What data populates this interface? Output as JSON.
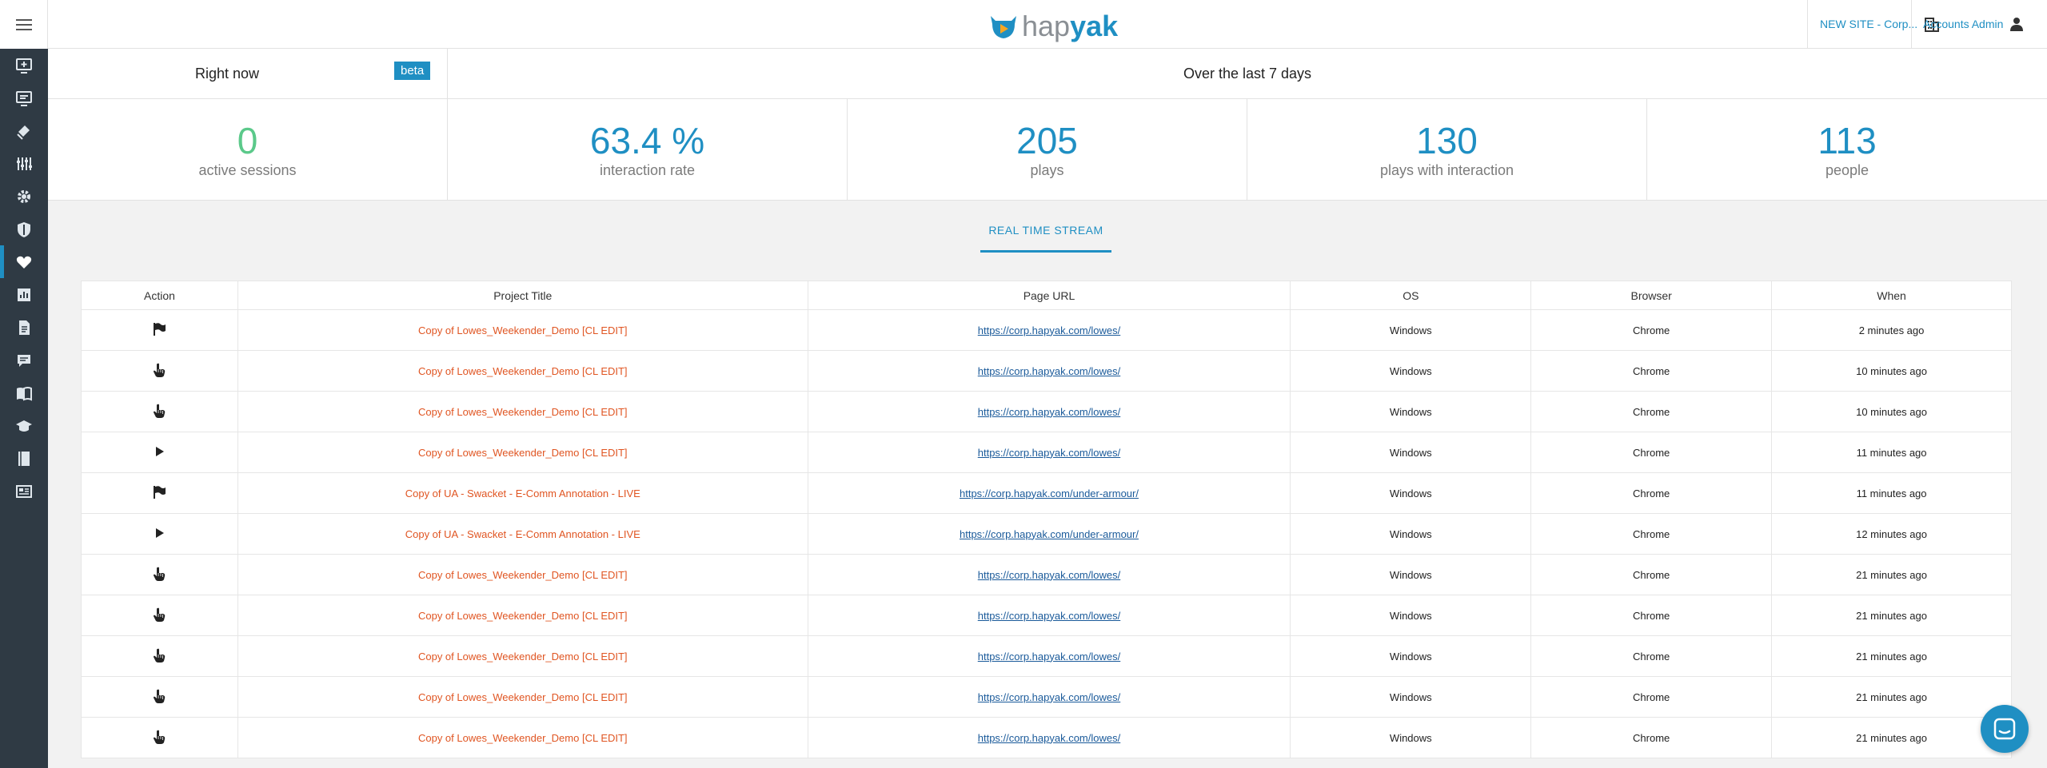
{
  "brand": {
    "part1": "hap",
    "part2": "yak",
    "accent": "#1f8fc3"
  },
  "header": {
    "site_label": "NEW SITE - Corp...",
    "account_label": "Accounts Admin"
  },
  "sidebar": {
    "items": [
      {
        "icon": "monitor-plus-icon"
      },
      {
        "icon": "screen-list-icon"
      },
      {
        "icon": "layers-icon"
      },
      {
        "icon": "sliders-icon"
      },
      {
        "icon": "gear-icon"
      },
      {
        "icon": "shield-icon"
      },
      {
        "icon": "heart-icon",
        "active": true
      },
      {
        "icon": "bar-chart-icon"
      },
      {
        "icon": "document-icon"
      },
      {
        "icon": "chat-icon"
      },
      {
        "icon": "book-open-icon"
      },
      {
        "icon": "graduation-cap-icon"
      },
      {
        "icon": "book-icon"
      },
      {
        "icon": "newspaper-icon"
      }
    ]
  },
  "stats": {
    "right_now": "Right now",
    "beta": "beta",
    "last7": "Over the last 7 days",
    "active_sessions": {
      "value": "0",
      "label": "active sessions"
    },
    "interaction_rate": {
      "value": "63.4 %",
      "label": "interaction rate"
    },
    "plays": {
      "value": "205",
      "label": "plays"
    },
    "plays_with_interaction": {
      "value": "130",
      "label": "plays with interaction"
    },
    "people": {
      "value": "113",
      "label": "people"
    }
  },
  "tab": {
    "label": "REAL TIME STREAM"
  },
  "table": {
    "headers": [
      "Action",
      "Project Title",
      "Page URL",
      "OS",
      "Browser",
      "When"
    ],
    "rows": [
      {
        "action": "flag-icon",
        "title": "Copy of Lowes_Weekender_Demo [CL EDIT]",
        "url": "https://corp.hapyak.com/lowes/",
        "os": "Windows",
        "browser": "Chrome",
        "when": "2 minutes ago"
      },
      {
        "action": "hand-pointer-icon",
        "title": "Copy of Lowes_Weekender_Demo [CL EDIT]",
        "url": "https://corp.hapyak.com/lowes/",
        "os": "Windows",
        "browser": "Chrome",
        "when": "10 minutes ago"
      },
      {
        "action": "hand-pointer-icon",
        "title": "Copy of Lowes_Weekender_Demo [CL EDIT]",
        "url": "https://corp.hapyak.com/lowes/",
        "os": "Windows",
        "browser": "Chrome",
        "when": "10 minutes ago"
      },
      {
        "action": "play-icon",
        "title": "Copy of Lowes_Weekender_Demo [CL EDIT]",
        "url": "https://corp.hapyak.com/lowes/",
        "os": "Windows",
        "browser": "Chrome",
        "when": "11 minutes ago"
      },
      {
        "action": "flag-icon",
        "title": "Copy of UA - Swacket - E-Comm Annotation - LIVE",
        "url": "https://corp.hapyak.com/under-armour/",
        "os": "Windows",
        "browser": "Chrome",
        "when": "11 minutes ago"
      },
      {
        "action": "play-icon",
        "title": "Copy of UA - Swacket - E-Comm Annotation - LIVE",
        "url": "https://corp.hapyak.com/under-armour/",
        "os": "Windows",
        "browser": "Chrome",
        "when": "12 minutes ago"
      },
      {
        "action": "hand-pointer-icon",
        "title": "Copy of Lowes_Weekender_Demo [CL EDIT]",
        "url": "https://corp.hapyak.com/lowes/",
        "os": "Windows",
        "browser": "Chrome",
        "when": "21 minutes ago"
      },
      {
        "action": "hand-pointer-icon",
        "title": "Copy of Lowes_Weekender_Demo [CL EDIT]",
        "url": "https://corp.hapyak.com/lowes/",
        "os": "Windows",
        "browser": "Chrome",
        "when": "21 minutes ago"
      },
      {
        "action": "hand-pointer-icon",
        "title": "Copy of Lowes_Weekender_Demo [CL EDIT]",
        "url": "https://corp.hapyak.com/lowes/",
        "os": "Windows",
        "browser": "Chrome",
        "when": "21 minutes ago"
      },
      {
        "action": "hand-pointer-icon",
        "title": "Copy of Lowes_Weekender_Demo [CL EDIT]",
        "url": "https://corp.hapyak.com/lowes/",
        "os": "Windows",
        "browser": "Chrome",
        "when": "21 minutes ago"
      },
      {
        "action": "hand-pointer-icon",
        "title": "Copy of Lowes_Weekender_Demo [CL EDIT]",
        "url": "https://corp.hapyak.com/lowes/",
        "os": "Windows",
        "browser": "Chrome",
        "when": "21 minutes ago"
      }
    ]
  }
}
